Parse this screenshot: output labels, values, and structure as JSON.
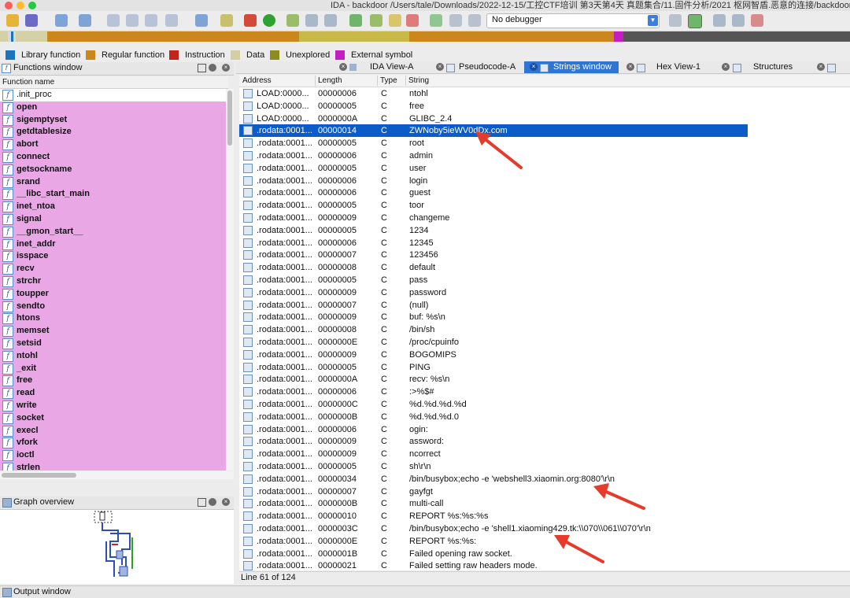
{
  "window": {
    "title": "IDA - backdoor /Users/tale/Downloads/2022-12-15/工控CTF培训 第3天第4天 真题集合/11.固件分析/2021 枢网智盾.恶意的连接/backdoor"
  },
  "toolbar": {
    "debugger_select": "No debugger"
  },
  "legend": [
    {
      "label": "Library function",
      "color": "#1e74bc"
    },
    {
      "label": "Regular function",
      "color": "#c9871c"
    },
    {
      "label": "Instruction",
      "color": "#c0241b"
    },
    {
      "label": "Data",
      "color": "#d3cfa4"
    },
    {
      "label": "Unexplored",
      "color": "#8c8c20"
    },
    {
      "label": "External symbol",
      "color": "#c21ec0"
    }
  ],
  "functions_window": {
    "title": "Functions window",
    "column": "Function name",
    "items": [
      ".init_proc",
      "open",
      "sigemptyset",
      "getdtablesize",
      "abort",
      "connect",
      "getsockname",
      "srand",
      "__libc_start_main",
      "inet_ntoa",
      "signal",
      "__gmon_start__",
      "inet_addr",
      "isspace",
      "recv",
      "strchr",
      "toupper",
      "sendto",
      "htons",
      "memset",
      "setsid",
      "ntohl",
      "_exit",
      "free",
      "read",
      "write",
      "socket",
      "execl",
      "vfork",
      "ioctl",
      "strlen"
    ]
  },
  "graph_overview": {
    "title": "Graph overview"
  },
  "output_window": {
    "title": "Output window"
  },
  "tabs": [
    "IDA View-A",
    "Pseudocode-A",
    "Strings window",
    "Hex View-1",
    "Structures"
  ],
  "strings_window": {
    "columns": [
      "Address",
      "Length",
      "Type",
      "String"
    ],
    "selected_index": 3,
    "status": "Line 61 of 124",
    "rows": [
      [
        "LOAD:0000...",
        "00000006",
        "C",
        "ntohl"
      ],
      [
        "LOAD:0000...",
        "00000005",
        "C",
        "free"
      ],
      [
        "LOAD:0000...",
        "0000000A",
        "C",
        "GLIBC_2.4"
      ],
      [
        ".rodata:0001...",
        "00000014",
        "C",
        "ZWNoby5ieWV0dDx.com"
      ],
      [
        ".rodata:0001...",
        "00000005",
        "C",
        "root"
      ],
      [
        ".rodata:0001...",
        "00000006",
        "C",
        "admin"
      ],
      [
        ".rodata:0001...",
        "00000005",
        "C",
        "user"
      ],
      [
        ".rodata:0001...",
        "00000006",
        "C",
        "login"
      ],
      [
        ".rodata:0001...",
        "00000006",
        "C",
        "guest"
      ],
      [
        ".rodata:0001...",
        "00000005",
        "C",
        "toor"
      ],
      [
        ".rodata:0001...",
        "00000009",
        "C",
        "changeme"
      ],
      [
        ".rodata:0001...",
        "00000005",
        "C",
        "1234"
      ],
      [
        ".rodata:0001...",
        "00000006",
        "C",
        "12345"
      ],
      [
        ".rodata:0001...",
        "00000007",
        "C",
        "123456"
      ],
      [
        ".rodata:0001...",
        "00000008",
        "C",
        "default"
      ],
      [
        ".rodata:0001...",
        "00000005",
        "C",
        "pass"
      ],
      [
        ".rodata:0001...",
        "00000009",
        "C",
        "password"
      ],
      [
        ".rodata:0001...",
        "00000007",
        "C",
        "(null)"
      ],
      [
        ".rodata:0001...",
        "00000009",
        "C",
        "buf: %s\\n"
      ],
      [
        ".rodata:0001...",
        "00000008",
        "C",
        "/bin/sh"
      ],
      [
        ".rodata:0001...",
        "0000000E",
        "C",
        "/proc/cpuinfo"
      ],
      [
        ".rodata:0001...",
        "00000009",
        "C",
        "BOGOMIPS"
      ],
      [
        ".rodata:0001...",
        "00000005",
        "C",
        "PING"
      ],
      [
        ".rodata:0001...",
        "0000000A",
        "C",
        "recv: %s\\n"
      ],
      [
        ".rodata:0001...",
        "00000006",
        "C",
        ":>%$#"
      ],
      [
        ".rodata:0001...",
        "0000000C",
        "C",
        "%d.%d.%d.%d"
      ],
      [
        ".rodata:0001...",
        "0000000B",
        "C",
        "%d.%d.%d.0"
      ],
      [
        ".rodata:0001...",
        "00000006",
        "C",
        "ogin:"
      ],
      [
        ".rodata:0001...",
        "00000009",
        "C",
        "assword:"
      ],
      [
        ".rodata:0001...",
        "00000009",
        "C",
        "ncorrect"
      ],
      [
        ".rodata:0001...",
        "00000005",
        "C",
        "sh\\r\\n"
      ],
      [
        ".rodata:0001...",
        "00000034",
        "C",
        "/bin/busybox;echo -e 'webshell3.xiaomin.org:8080'\\r\\n"
      ],
      [
        ".rodata:0001...",
        "00000007",
        "C",
        "gayfgt"
      ],
      [
        ".rodata:0001...",
        "0000000B",
        "C",
        "multi-call"
      ],
      [
        ".rodata:0001...",
        "00000010",
        "C",
        "REPORT %s:%s:%s"
      ],
      [
        ".rodata:0001...",
        "0000003C",
        "C",
        "/bin/busybox;echo -e 'shell1.xiaoming429.tk:\\\\070\\\\061\\\\070'\\r\\n"
      ],
      [
        ".rodata:0001...",
        "0000000E",
        "C",
        "REPORT %s:%s:"
      ],
      [
        ".rodata:0001...",
        "0000001B",
        "C",
        "Failed opening raw socket."
      ],
      [
        ".rodata:0001...",
        "00000021",
        "C",
        "Failed setting raw headers mode."
      ]
    ]
  }
}
